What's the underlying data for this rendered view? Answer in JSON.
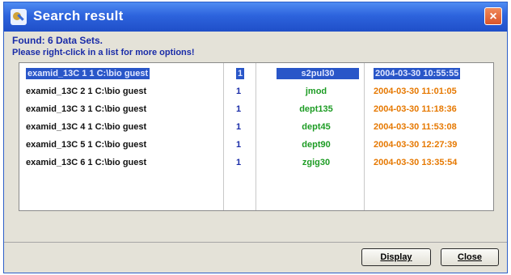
{
  "window": {
    "title": "Search result",
    "close_glyph": "×"
  },
  "info": {
    "found": "Found: 6 Data Sets.",
    "hint": "Please right-click in a list for more options!"
  },
  "results": [
    {
      "name": "examid_13C 1 1 C:\\bio guest",
      "num": "1",
      "label": "s2pul30",
      "time": "2004-03-30 10:55:55",
      "selected": true
    },
    {
      "name": "examid_13C 2 1 C:\\bio guest",
      "num": "1",
      "label": "jmod",
      "time": "2004-03-30 11:01:05",
      "selected": false
    },
    {
      "name": "examid_13C 3 1 C:\\bio guest",
      "num": "1",
      "label": "dept135",
      "time": "2004-03-30 11:18:36",
      "selected": false
    },
    {
      "name": "examid_13C 4 1 C:\\bio guest",
      "num": "1",
      "label": "dept45",
      "time": "2004-03-30 11:53:08",
      "selected": false
    },
    {
      "name": "examid_13C 5 1 C:\\bio guest",
      "num": "1",
      "label": "dept90",
      "time": "2004-03-30 12:27:39",
      "selected": false
    },
    {
      "name": "examid_13C 6 1 C:\\bio guest",
      "num": "1",
      "label": "zgig30",
      "time": "2004-03-30 13:35:54",
      "selected": false
    }
  ],
  "buttons": {
    "display": "Display",
    "close": "Close"
  },
  "colors": {
    "title_bar": "#2d63dd",
    "selection": "#2956c8",
    "name_text": "#111111",
    "number_text": "#1a2ca8",
    "label_text": "#1d9c24",
    "time_text": "#e67800"
  }
}
